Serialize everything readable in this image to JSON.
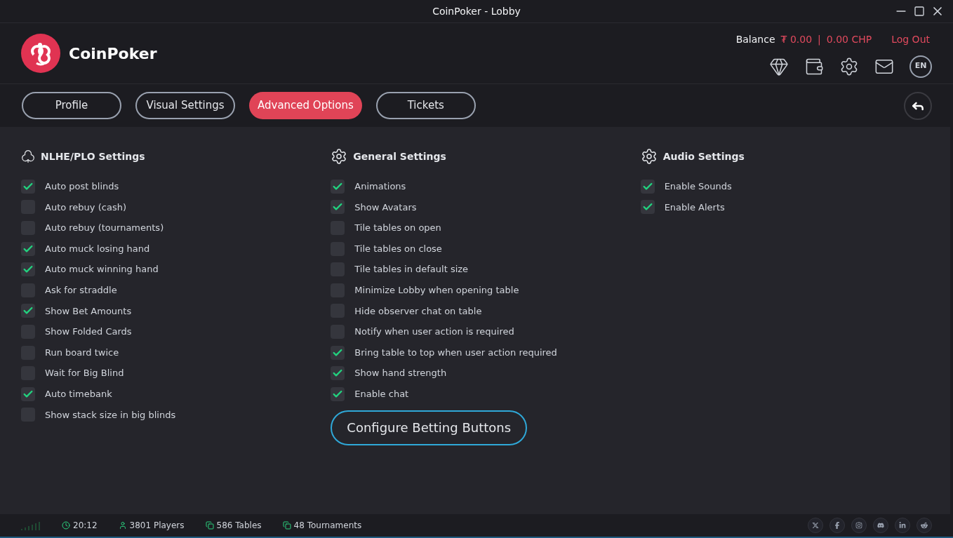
{
  "window": {
    "title": "CoinPoker - Lobby"
  },
  "header": {
    "brand": "CoinPoker",
    "balance_label": "Balance",
    "balance_token": "₮ 0.00",
    "separator": "|",
    "balance_chp": "0.00 CHP",
    "logout": "Log Out",
    "language": "EN"
  },
  "tabs": [
    {
      "label": "Profile",
      "selected": false
    },
    {
      "label": "Visual Settings",
      "selected": false
    },
    {
      "label": "Advanced Options",
      "selected": true
    },
    {
      "label": "Tickets",
      "selected": false
    }
  ],
  "sections": [
    {
      "kind": "club",
      "title": "NLHE/PLO Settings",
      "options": [
        {
          "label": "Auto post blinds",
          "checked": true
        },
        {
          "label": "Auto rebuy (cash)",
          "checked": false
        },
        {
          "label": "Auto rebuy (tournaments)",
          "checked": false
        },
        {
          "label": "Auto muck losing hand",
          "checked": true
        },
        {
          "label": "Auto muck winning hand",
          "checked": true
        },
        {
          "label": "Ask for straddle",
          "checked": false
        },
        {
          "label": "Show Bet Amounts",
          "checked": true
        },
        {
          "label": "Show Folded Cards",
          "checked": false
        },
        {
          "label": "Run board twice",
          "checked": false
        },
        {
          "label": "Wait for Big Blind",
          "checked": false
        },
        {
          "label": "Auto timebank",
          "checked": true
        },
        {
          "label": "Show stack size in big blinds",
          "checked": false
        }
      ]
    },
    {
      "kind": "gear",
      "title": "General Settings",
      "options": [
        {
          "label": "Animations",
          "checked": true
        },
        {
          "label": "Show Avatars",
          "checked": true
        },
        {
          "label": "Tile tables on open",
          "checked": false
        },
        {
          "label": "Tile tables on close",
          "checked": false
        },
        {
          "label": "Tile tables in default size",
          "checked": false
        },
        {
          "label": "Minimize Lobby when opening table",
          "checked": false
        },
        {
          "label": "Hide observer chat on table",
          "checked": false
        },
        {
          "label": "Notify when user action is required",
          "checked": false
        },
        {
          "label": "Bring table to top when user action required",
          "checked": true
        },
        {
          "label": "Show hand strength",
          "checked": true
        },
        {
          "label": "Enable chat",
          "checked": true
        }
      ],
      "button": "Configure Betting Buttons"
    },
    {
      "kind": "gear",
      "title": "Audio Settings",
      "options": [
        {
          "label": "Enable Sounds",
          "checked": true
        },
        {
          "label": "Enable Alerts",
          "checked": true
        }
      ]
    }
  ],
  "status_bar": {
    "time": "20:12",
    "players": "3801 Players",
    "tables": "586 Tables",
    "tournaments": "48 Tournaments"
  }
}
